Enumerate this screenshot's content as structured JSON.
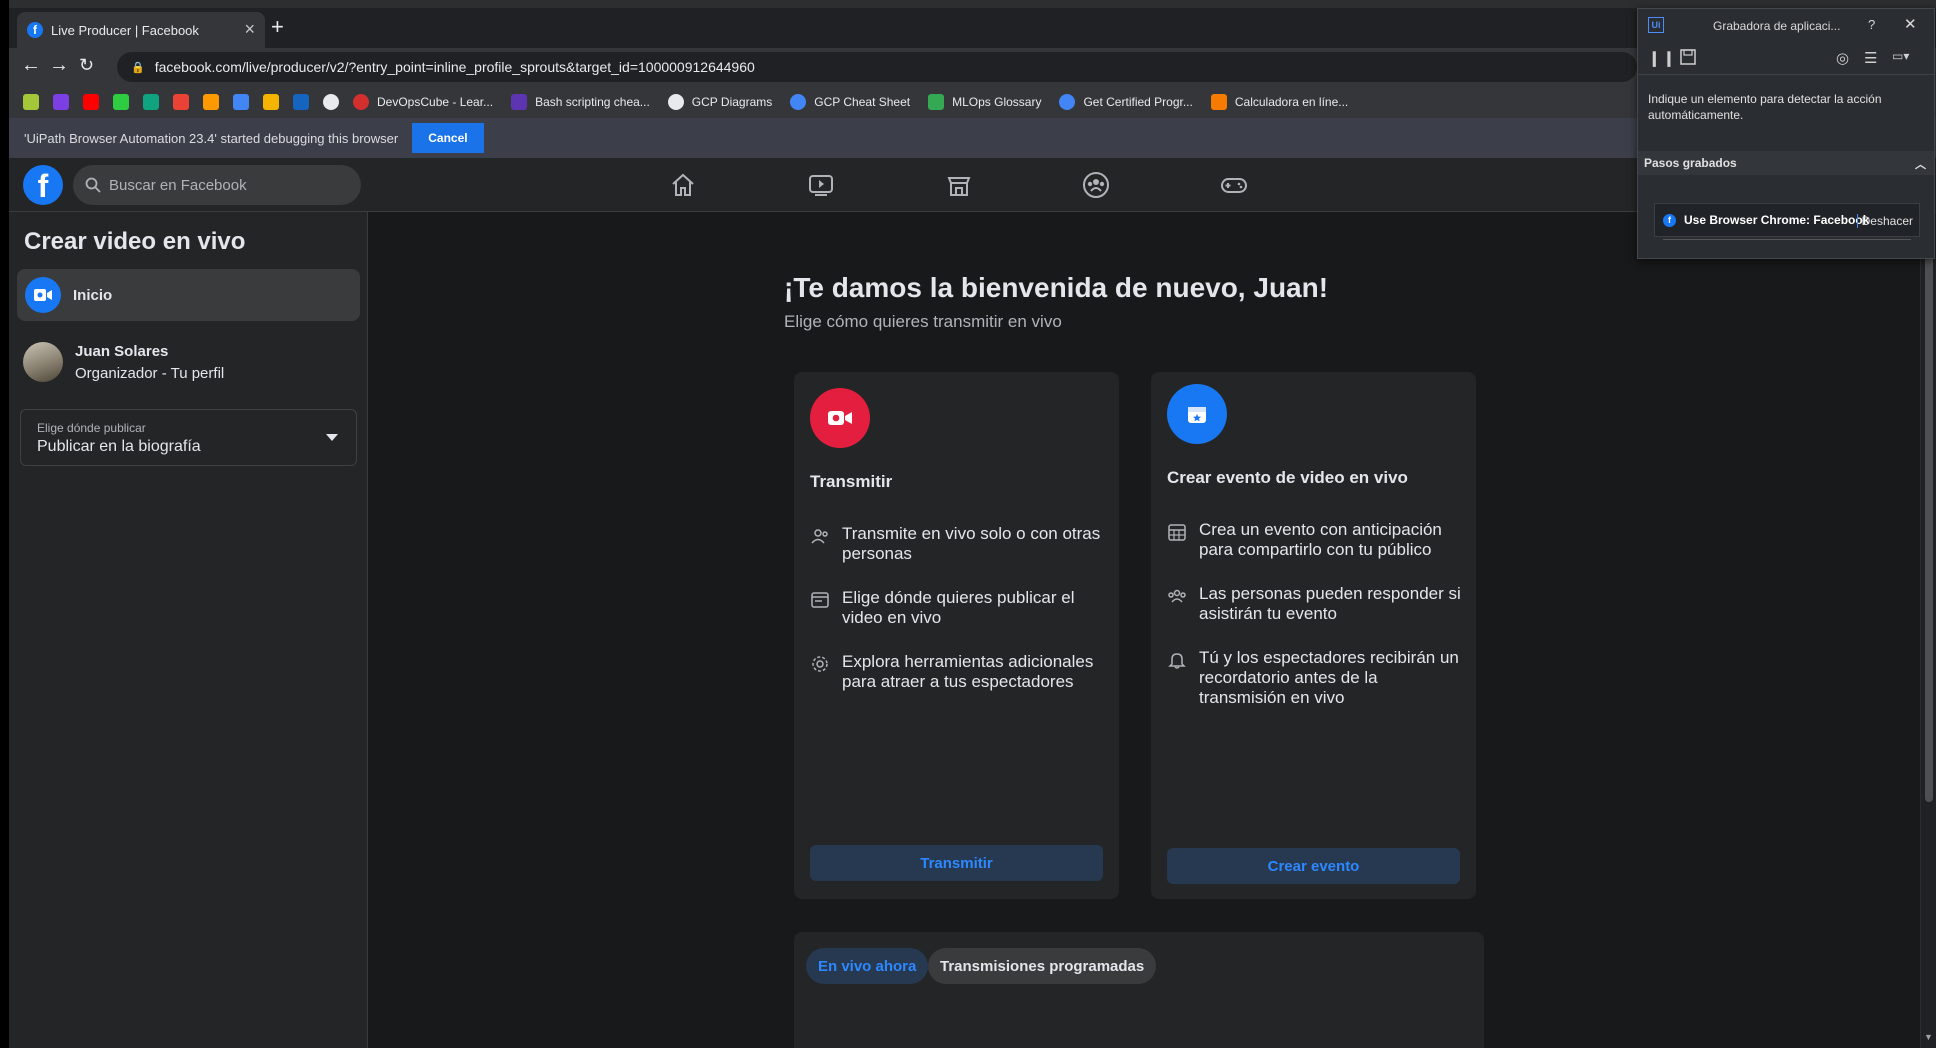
{
  "browser": {
    "tab_title": "Live Producer | Facebook",
    "url": "facebook.com/live/producer/v2/?entry_point=inline_profile_sprouts&target_id=100000912644960",
    "bookmarks": [
      "DevOpsCube - Lear...",
      "Bash scripting chea...",
      "GCP Diagrams",
      "GCP Cheat Sheet",
      "MLOps Glossary",
      "Get Certified Progr...",
      "Calculadora en líne..."
    ],
    "debug_message": "'UiPath Browser Automation 23.4' started debugging this browser",
    "debug_cancel": "Cancel"
  },
  "facebook": {
    "search_placeholder": "Buscar en Facebook",
    "sidebar": {
      "title": "Crear video en vivo",
      "home_label": "Inicio",
      "user_name": "Juan Solares",
      "user_sub": "Organizador - Tu perfil",
      "publish_label": "Elige dónde publicar",
      "publish_value": "Publicar en la biografía"
    },
    "main": {
      "welcome": "¡Te damos la bienvenida de nuevo, Juan!",
      "welcome_sub": "Elige cómo quieres transmitir en vivo",
      "card_live": {
        "title": "Transmitir",
        "features": [
          "Transmite en vivo solo o con otras personas",
          "Elige dónde quieres publicar el video en vivo",
          "Explora herramientas adicionales para atraer a tus espectadores"
        ],
        "button": "Transmitir"
      },
      "card_event": {
        "title": "Crear evento de video en vivo",
        "features": [
          "Crea un evento con anticipación para compartirlo con tu público",
          "Las personas pueden responder si asistirán tu evento",
          "Tú y los espectadores recibirán un recordatorio antes de la transmisión en vivo"
        ],
        "button": "Crear evento"
      },
      "tabs": [
        "En vivo ahora",
        "Transmisiones programadas"
      ]
    }
  },
  "uipath": {
    "title": "Grabadora de aplicaci...",
    "help": "?",
    "hint": "Indique un elemento para detectar la acción automáticamente.",
    "steps_header": "Pasos grabados",
    "step_label": "Use Browser Chrome: Facebook",
    "step_undo": "Deshacer"
  },
  "colors": {
    "fb_blue": "#1877f2",
    "live_red": "#e41e3f",
    "button_text": "#2d88ff"
  }
}
